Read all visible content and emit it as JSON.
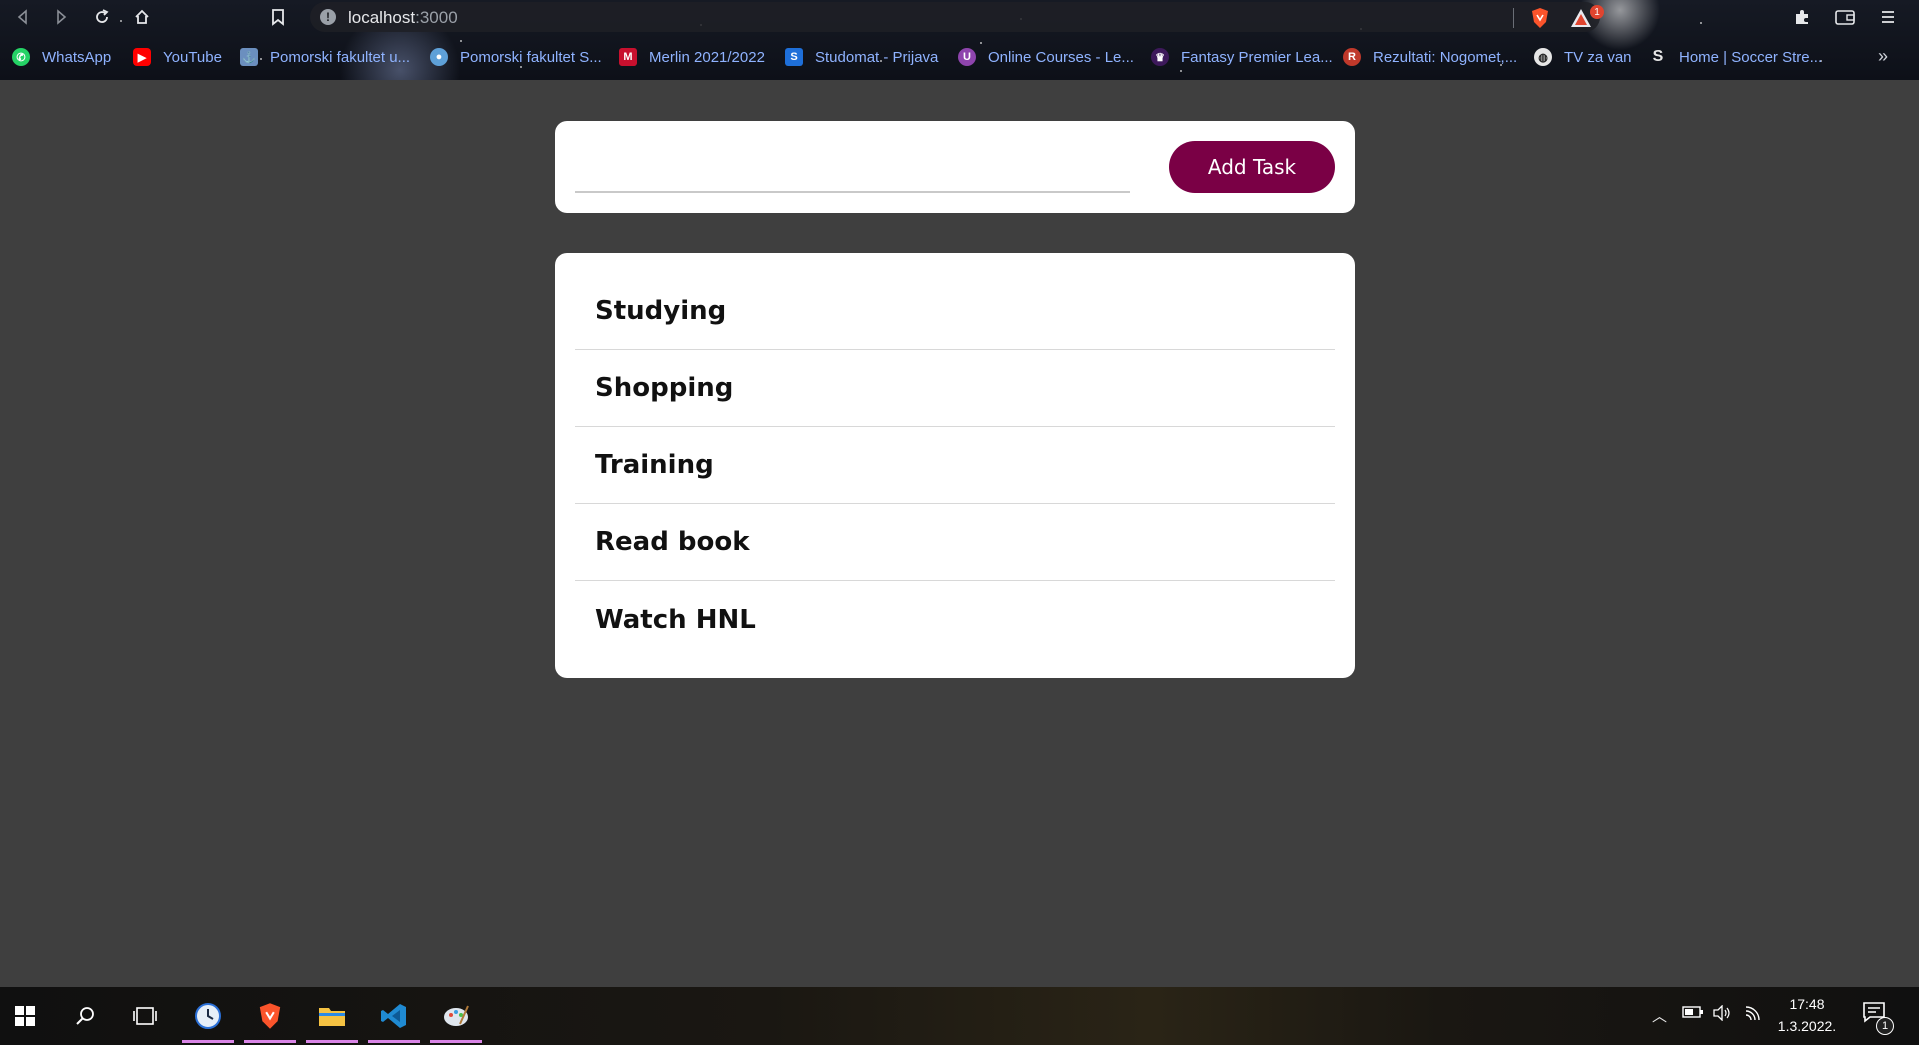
{
  "browser": {
    "url_host": "localhost",
    "url_port": ":3000",
    "rewards_badge": "1",
    "bookmarks": [
      {
        "label": "WhatsApp",
        "icon": "whatsapp-icon",
        "color": "#25d366"
      },
      {
        "label": "YouTube",
        "icon": "youtube-icon",
        "color": "#ff0000"
      },
      {
        "label": "Pomorski fakultet u...",
        "icon": "faculty-icon",
        "color": "#6b8fbf"
      },
      {
        "label": "Pomorski fakultet S...",
        "icon": "faculty-s-icon",
        "color": "#5ea0d8"
      },
      {
        "label": "Merlin 2021/2022",
        "icon": "merlin-icon",
        "color": "#c8102e"
      },
      {
        "label": "Studomat - Prijava",
        "icon": "studomat-icon",
        "color": "#1e6fd9"
      },
      {
        "label": "Online Courses - Le...",
        "icon": "udemy-icon",
        "color": "#8e44ad"
      },
      {
        "label": "Fantasy Premier Lea...",
        "icon": "premier-league-icon",
        "color": "#3d195b"
      },
      {
        "label": "Rezultati: Nogomet,...",
        "icon": "rezultati-icon",
        "color": "#c0392b"
      },
      {
        "label": "TV za van",
        "icon": "globe-icon",
        "color": "#e6e6e6"
      },
      {
        "label": "Home | Soccer Stre...",
        "icon": "soccer-icon",
        "color": "#e6e6e6"
      }
    ]
  },
  "app": {
    "input_value": "",
    "add_button_label": "Add Task",
    "accent_color": "#7a0045",
    "tasks": [
      "Studying",
      "Shopping",
      "Training",
      "Read book",
      "Watch HNL"
    ]
  },
  "taskbar": {
    "time": "17:48",
    "date": "1.3.2022.",
    "notification_count": "1"
  }
}
